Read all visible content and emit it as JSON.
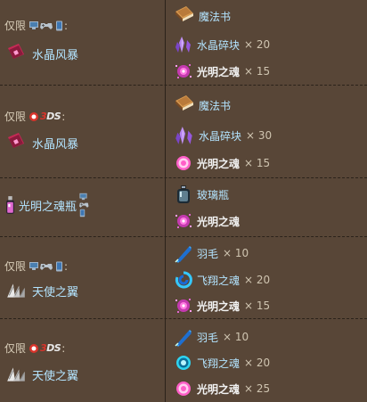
{
  "rows": [
    {
      "restriction": "仅限",
      "platform_icons": [
        "pc-icon",
        "controller-icon",
        "mobile-icon"
      ],
      "result": {
        "name": "水晶风暴",
        "icon": "crystal-storm-book-icon"
      },
      "ingredients": [
        {
          "name": "魔法书",
          "qty": "",
          "icon": "spell-tome-icon",
          "bold": false
        },
        {
          "name": "水晶碎块",
          "qty": "× 20",
          "icon": "crystal-shard-icon",
          "bold": false
        },
        {
          "name": "光明之魂",
          "qty": "× 15",
          "icon": "soul-of-light-icon",
          "bold": true
        }
      ]
    },
    {
      "restriction": "仅限",
      "platform_icons": [
        "3ds-icon"
      ],
      "result": {
        "name": "水晶风暴",
        "icon": "crystal-storm-book-icon"
      },
      "ingredients": [
        {
          "name": "魔法书",
          "qty": "",
          "icon": "spell-tome-icon",
          "bold": false
        },
        {
          "name": "水晶碎块",
          "qty": "× 30",
          "icon": "crystal-shard-icon",
          "bold": false
        },
        {
          "name": "光明之魂",
          "qty": "× 15",
          "icon": "soul-of-light-icon",
          "bold": true
        }
      ]
    },
    {
      "restriction": "",
      "platform_icons": [
        "pc-icon",
        "controller-icon",
        "mobile-icon"
      ],
      "result": {
        "name": "光明之魂瓶",
        "icon": "bottled-light-soul-icon"
      },
      "ingredients": [
        {
          "name": "玻璃瓶",
          "qty": "",
          "icon": "glass-bottle-icon",
          "bold": false
        },
        {
          "name": "光明之魂",
          "qty": "",
          "icon": "soul-of-light-icon",
          "bold": true
        }
      ]
    },
    {
      "restriction": "仅限",
      "platform_icons": [
        "pc-icon",
        "controller-icon",
        "mobile-icon"
      ],
      "result": {
        "name": "天使之翼",
        "icon": "angel-wings-icon"
      },
      "ingredients": [
        {
          "name": "羽毛",
          "qty": "× 10",
          "icon": "feather-icon",
          "bold": false
        },
        {
          "name": "飞翔之魂",
          "qty": "× 20",
          "icon": "soul-of-flight-icon",
          "bold": false
        },
        {
          "name": "光明之魂",
          "qty": "× 15",
          "icon": "soul-of-light-icon",
          "bold": true
        }
      ]
    },
    {
      "restriction": "仅限",
      "platform_icons": [
        "3ds-icon"
      ],
      "result": {
        "name": "天使之翼",
        "icon": "angel-wings-icon"
      },
      "ingredients": [
        {
          "name": "羽毛",
          "qty": "× 10",
          "icon": "feather-icon",
          "bold": false
        },
        {
          "name": "飞翔之魂",
          "qty": "× 20",
          "icon": "soul-of-flight-icon",
          "bold": false
        },
        {
          "name": "光明之魂",
          "qty": "× 25",
          "icon": "soul-of-light-icon",
          "bold": true
        }
      ]
    }
  ],
  "labels": {
    "ds_text": "DS",
    "ds_num": "3",
    "colon": ":"
  },
  "colors": {
    "background": "#584637",
    "divider": "#2b221a",
    "link_text": "#b3e4ff",
    "soul_pink": "#e84fd0",
    "crystal_purple": "#8a4fd0",
    "flight_cyan": "#35c8ff"
  }
}
